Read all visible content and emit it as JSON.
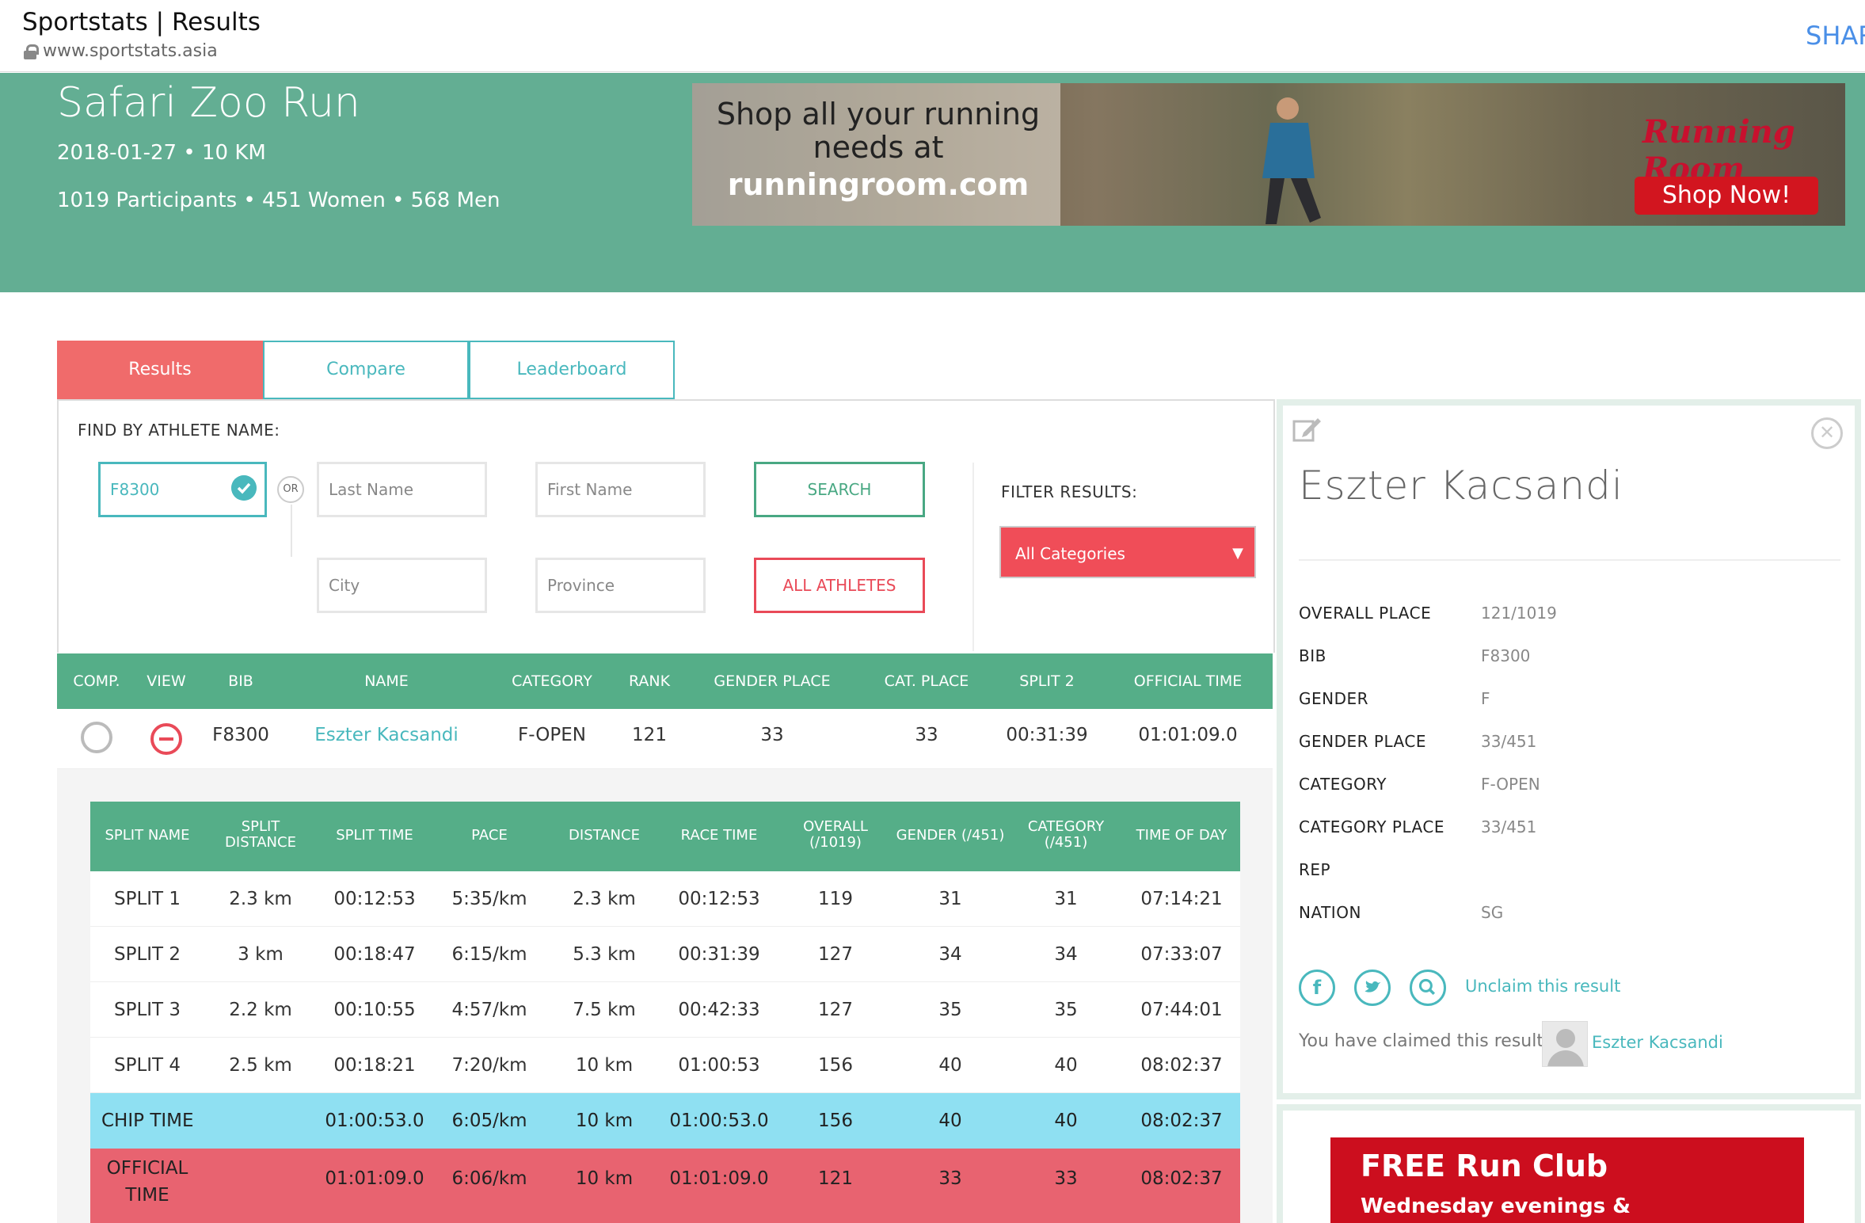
{
  "browser": {
    "title": "Sportstats | Results",
    "url": "www.sportstats.asia",
    "share_label": "SHAR"
  },
  "event": {
    "name": "Safari Zoo Run",
    "meta": "2018-01-27 • 10 KM",
    "participants": "1019 Participants • 451 Women • 568 Men"
  },
  "ad_banner": {
    "line1": "Shop all your running",
    "line2": "needs at",
    "line3": "runningroom.com",
    "brand": "Running Room",
    "shop_button": "Shop Now!"
  },
  "tabs": [
    {
      "label": "Results",
      "active": true
    },
    {
      "label": "Compare",
      "active": false
    },
    {
      "label": "Leaderboard",
      "active": false
    }
  ],
  "search": {
    "find_label": "FIND BY ATHLETE NAME:",
    "bib_value": "F8300",
    "or_label": "OR",
    "last_name_placeholder": "Last Name",
    "first_name_placeholder": "First Name",
    "city_placeholder": "City",
    "province_placeholder": "Province",
    "search_button": "SEARCH",
    "all_athletes_button": "ALL ATHLETES",
    "filter_label": "FILTER RESULTS:",
    "category_selected": "All Categories"
  },
  "results_table": {
    "headers": [
      "COMP.",
      "VIEW",
      "BIB",
      "NAME",
      "CATEGORY",
      "RANK",
      "GENDER PLACE",
      "CAT. PLACE",
      "SPLIT 2",
      "OFFICIAL TIME"
    ],
    "row": {
      "bib": "F8300",
      "name": "Eszter Kacsandi",
      "category": "F-OPEN",
      "rank": "121",
      "gender_place": "33",
      "cat_place": "33",
      "split2": "00:31:39",
      "official_time": "01:01:09.0"
    }
  },
  "splits": {
    "headers": [
      "SPLIT NAME",
      "SPLIT\nDISTANCE",
      "SPLIT TIME",
      "PACE",
      "DISTANCE",
      "RACE TIME",
      "OVERALL\n(/1019)",
      "GENDER (/451)",
      "CATEGORY\n(/451)",
      "TIME OF DAY"
    ],
    "rows": [
      [
        "SPLIT 1",
        "2.3 km",
        "00:12:53",
        "5:35/km",
        "2.3 km",
        "00:12:53",
        "119",
        "31",
        "31",
        "07:14:21"
      ],
      [
        "SPLIT 2",
        "3 km",
        "00:18:47",
        "6:15/km",
        "5.3 km",
        "00:31:39",
        "127",
        "34",
        "34",
        "07:33:07"
      ],
      [
        "SPLIT 3",
        "2.2 km",
        "00:10:55",
        "4:57/km",
        "7.5 km",
        "00:42:33",
        "127",
        "35",
        "35",
        "07:44:01"
      ],
      [
        "SPLIT 4",
        "2.5 km",
        "00:18:21",
        "7:20/km",
        "10 km",
        "01:00:53",
        "156",
        "40",
        "40",
        "08:02:37"
      ]
    ],
    "chip": [
      "CHIP TIME",
      "",
      "01:00:53.0",
      "6:05/km",
      "10 km",
      "01:00:53.0",
      "156",
      "40",
      "40",
      "08:02:37"
    ],
    "official": [
      "OFFICIAL\nTIME",
      "",
      "01:01:09.0",
      "6:06/km",
      "10 km",
      "01:01:09.0",
      "121",
      "33",
      "33",
      "08:02:37"
    ]
  },
  "athlete_card": {
    "name": "Eszter Kacsandi",
    "details": [
      {
        "label": "OVERALL PLACE",
        "value": "121/1019"
      },
      {
        "label": "BIB",
        "value": "F8300"
      },
      {
        "label": "GENDER",
        "value": "F"
      },
      {
        "label": "GENDER PLACE",
        "value": "33/451"
      },
      {
        "label": "CATEGORY",
        "value": "F-OPEN"
      },
      {
        "label": "CATEGORY PLACE",
        "value": "33/451"
      },
      {
        "label": "REP",
        "value": ""
      },
      {
        "label": "NATION",
        "value": "SG"
      }
    ],
    "unclaim_link": "Unclaim this result",
    "claimed_text": "You have claimed this result.",
    "claimed_name": "Eszter Kacsandi"
  },
  "bottom_ad": {
    "title": "FREE Run Club",
    "subtitle": "Wednesday evenings &"
  }
}
